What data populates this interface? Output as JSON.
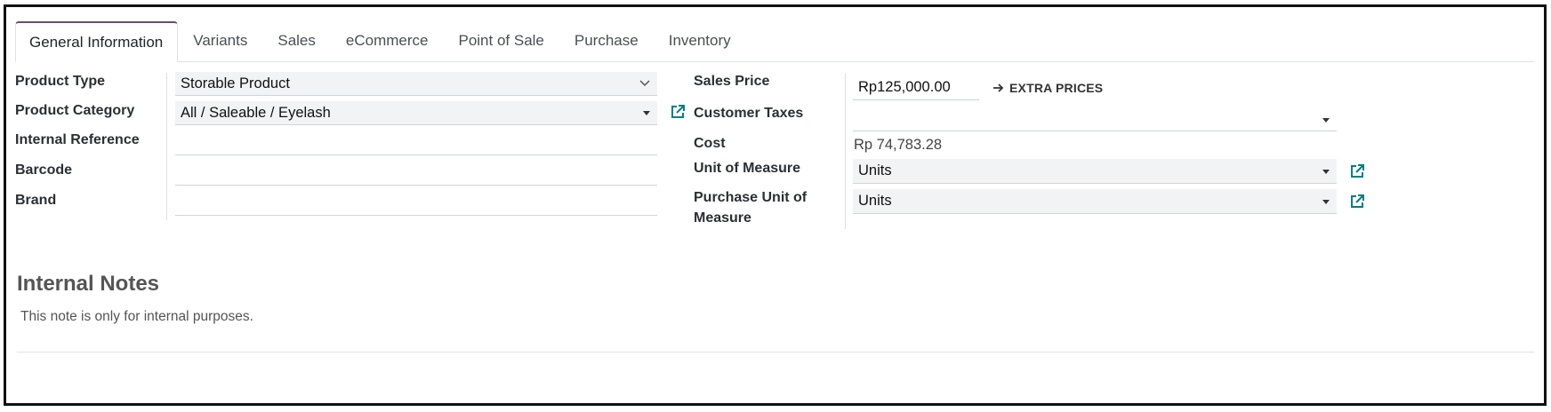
{
  "tabs": [
    {
      "label": "General Information",
      "active": true
    },
    {
      "label": "Variants"
    },
    {
      "label": "Sales"
    },
    {
      "label": "eCommerce"
    },
    {
      "label": "Point of Sale"
    },
    {
      "label": "Purchase"
    },
    {
      "label": "Inventory"
    }
  ],
  "left": {
    "product_type": {
      "label": "Product Type",
      "value": "Storable Product"
    },
    "product_category": {
      "label": "Product Category",
      "value": "All / Saleable / Eyelash"
    },
    "internal_reference": {
      "label": "Internal Reference",
      "value": ""
    },
    "barcode": {
      "label": "Barcode",
      "value": ""
    },
    "brand": {
      "label": "Brand",
      "value": ""
    }
  },
  "right": {
    "sales_price": {
      "label": "Sales Price",
      "value": "Rp125,000.00",
      "extra_label": "EXTRA PRICES"
    },
    "customer_taxes": {
      "label": "Customer Taxes",
      "value": ""
    },
    "cost": {
      "label": "Cost",
      "value": "Rp 74,783.28"
    },
    "uom": {
      "label": "Unit of Measure",
      "value": "Units"
    },
    "purchase_uom": {
      "label_line1": "Purchase Unit of",
      "label_line2": "Measure",
      "value": "Units"
    }
  },
  "notes": {
    "title": "Internal Notes",
    "placeholder": "This note is only for internal purposes."
  },
  "colors": {
    "accent": "#714b67",
    "link_icon": "#017e84"
  }
}
